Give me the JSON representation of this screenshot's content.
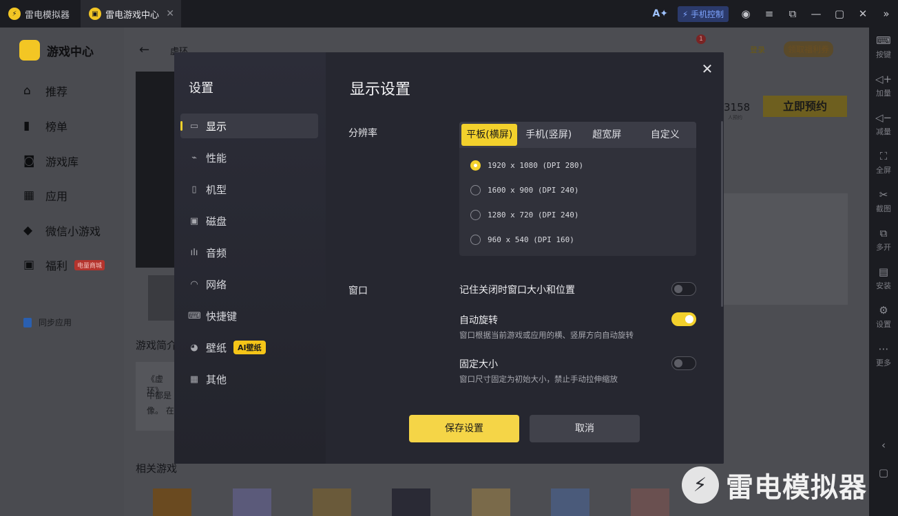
{
  "titlebar": {
    "tabs": [
      {
        "label": "雷电模拟器"
      },
      {
        "label": "雷电游戏中心"
      }
    ],
    "phone_control": "手机控制"
  },
  "right_toolbar": [
    {
      "label": "按键",
      "icon": "keyboard-icon"
    },
    {
      "label": "加量",
      "icon": "volume-up-icon"
    },
    {
      "label": "减量",
      "icon": "volume-down-icon"
    },
    {
      "label": "全屏",
      "icon": "fullscreen-icon"
    },
    {
      "label": "截图",
      "icon": "scissors-icon"
    },
    {
      "label": "多开",
      "icon": "multi-window-icon"
    },
    {
      "label": "安装",
      "icon": "install-icon"
    },
    {
      "label": "设置",
      "icon": "gear-icon"
    },
    {
      "label": "更多",
      "icon": "more-icon"
    }
  ],
  "app": {
    "logo": "游戏中心",
    "nav": [
      {
        "label": "推荐"
      },
      {
        "label": "榜单"
      },
      {
        "label": "游戏库"
      },
      {
        "label": "应用"
      },
      {
        "label": "微信小游戏"
      },
      {
        "label": "福利",
        "badge": "电量商城"
      }
    ],
    "sync": "同步应用",
    "search_value": "虚环",
    "header": {
      "login": "登录",
      "coupon": "领取福利券",
      "notif_count": "1"
    },
    "count": "3158",
    "count_sub": "人预约",
    "reserve": "立即预约",
    "intro_title": "游戏简介",
    "intro_lines": [
      "《虚环》",
      "中都是",
      "像。 在"
    ],
    "related_title": "相关游戏"
  },
  "dialog": {
    "sidebar_title": "设置",
    "sidebar_items": [
      {
        "label": "显示",
        "icon": "monitor-icon"
      },
      {
        "label": "性能",
        "icon": "performance-icon"
      },
      {
        "label": "机型",
        "icon": "phone-icon"
      },
      {
        "label": "磁盘",
        "icon": "disk-icon"
      },
      {
        "label": "音频",
        "icon": "audio-icon"
      },
      {
        "label": "网络",
        "icon": "wifi-icon"
      },
      {
        "label": "快捷键",
        "icon": "keyboard-icon"
      },
      {
        "label": "壁纸",
        "icon": "palette-icon",
        "badge": "AI壁纸"
      },
      {
        "label": "其他",
        "icon": "grid-icon"
      }
    ],
    "heading": "显示设置",
    "resolution_label": "分辨率",
    "resolution_tabs": [
      "平板(横屏)",
      "手机(竖屏)",
      "超宽屏",
      "自定义"
    ],
    "resolution_options": [
      "1920 x 1080 (DPI 280)",
      "1600 x 900 (DPI 240)",
      "1280 x 720 (DPI 240)",
      "960 x 540 (DPI 160)"
    ],
    "window_label": "窗口",
    "window_options": [
      {
        "title": "记住关闭时窗口大小和位置",
        "desc": "",
        "enabled": false
      },
      {
        "title": "自动旋转",
        "desc": "窗口根据当前游戏或应用的横、竖屏方向自动旋转",
        "enabled": true
      },
      {
        "title": "固定大小",
        "desc": "窗口尺寸固定为初始大小，禁止手动拉伸缩放",
        "enabled": false
      }
    ],
    "save": "保存设置",
    "cancel": "取消"
  },
  "watermark": "雷电模拟器"
}
